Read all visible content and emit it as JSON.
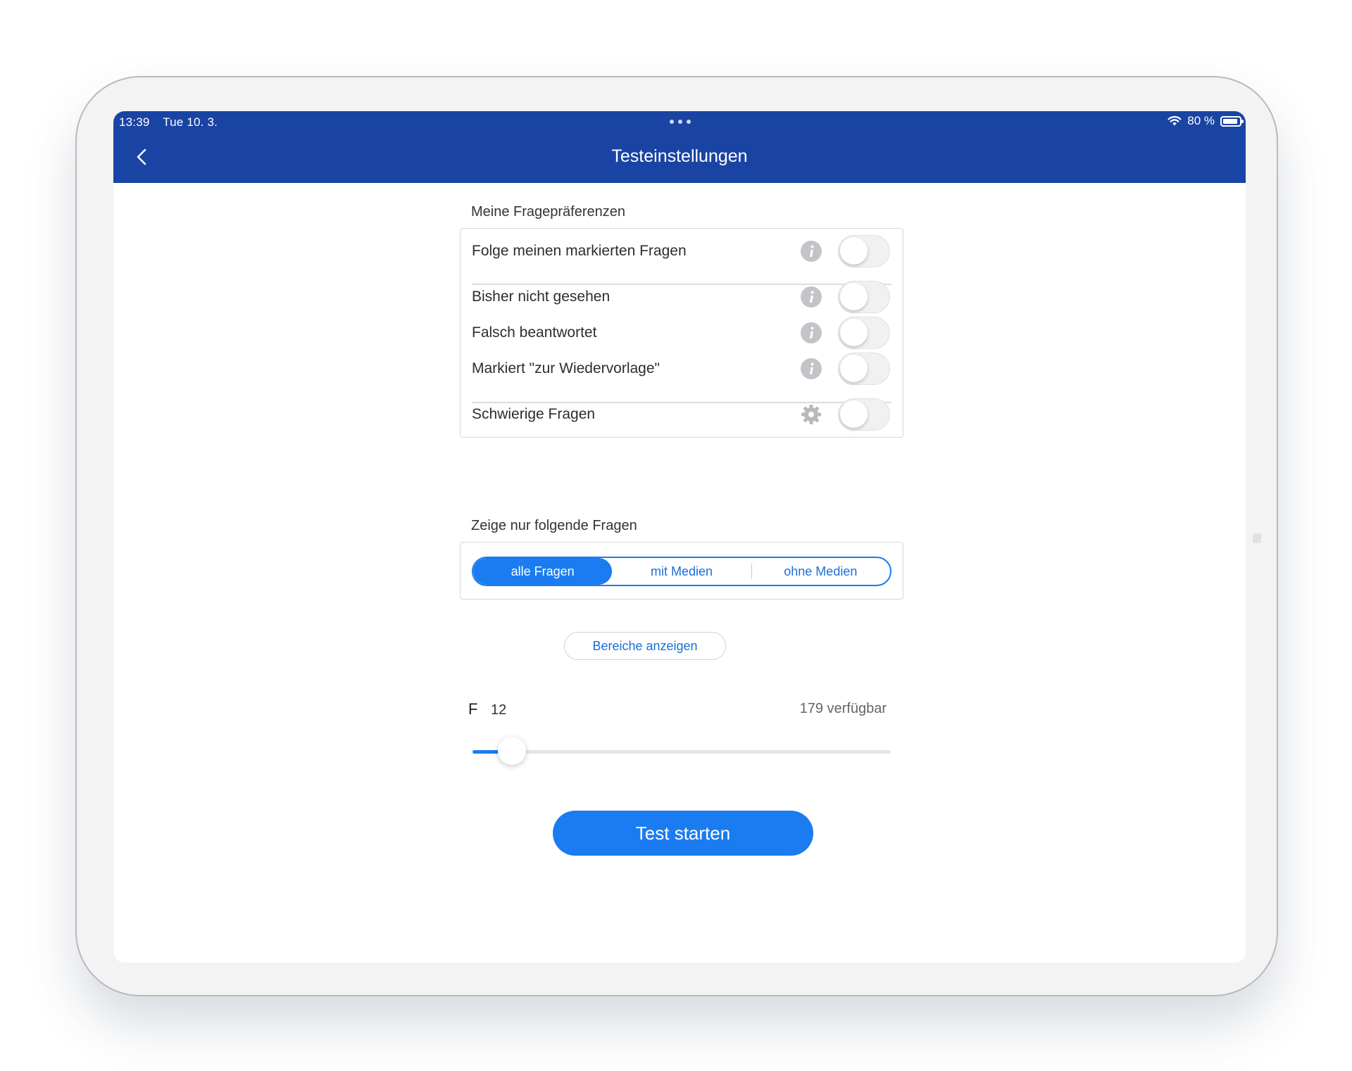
{
  "status_bar": {
    "time": "13:39",
    "date": "Tue 10. 3.",
    "battery": "80 %"
  },
  "nav": {
    "title": "Testeinstellungen"
  },
  "preferences": {
    "section_title": "Meine Fragepräferenzen",
    "rows": [
      {
        "label": "Folge meinen markierten Fragen",
        "icon": "info-icon",
        "enabled": false
      },
      {
        "label": "Bisher nicht gesehen",
        "icon": "info-icon",
        "enabled": false
      },
      {
        "label": "Falsch beantwortet",
        "icon": "info-icon",
        "enabled": false
      },
      {
        "label": "Markiert \"zur Wiedervorlage\"",
        "icon": "info-icon",
        "enabled": false
      },
      {
        "label": "Schwierige Fragen",
        "icon": "gear-icon",
        "enabled": false
      }
    ]
  },
  "filter": {
    "section_title": "Zeige nur folgende Fragen",
    "options": [
      "alle Fragen",
      "mit Medien",
      "ohne Medien"
    ],
    "selected": "alle Fragen"
  },
  "areas_button": "Bereiche anzeigen",
  "question_count": {
    "label": "F",
    "value": "12",
    "available": "179 verfügbar",
    "min": 0,
    "max": 179,
    "current": 12
  },
  "start_button": "Test starten",
  "colors": {
    "nav_bar": "#1a44a3",
    "accent": "#1a7cf0"
  }
}
